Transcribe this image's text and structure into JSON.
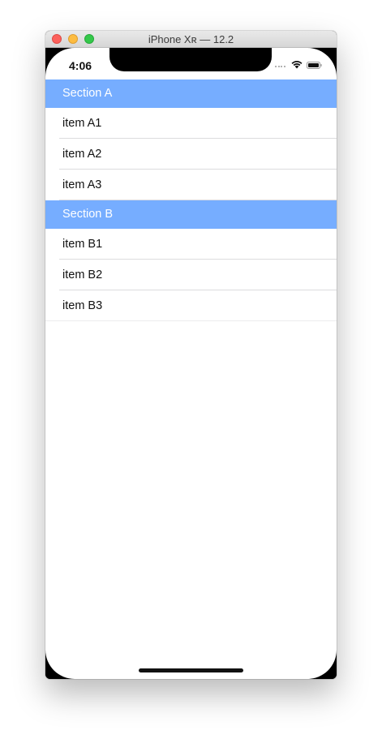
{
  "window": {
    "title": "iPhone Xʀ — 12.2"
  },
  "status_bar": {
    "time": "4:06",
    "icons": [
      "signal-dots-icon",
      "wifi-icon",
      "battery-icon"
    ]
  },
  "sections": [
    {
      "header": "Section A",
      "items": [
        "item A1",
        "item A2",
        "item A3"
      ]
    },
    {
      "header": "Section B",
      "items": [
        "item B1",
        "item B2",
        "item B3"
      ]
    }
  ],
  "colors": {
    "section_header_bg": "#76adff",
    "section_header_text": "#ffffff"
  }
}
